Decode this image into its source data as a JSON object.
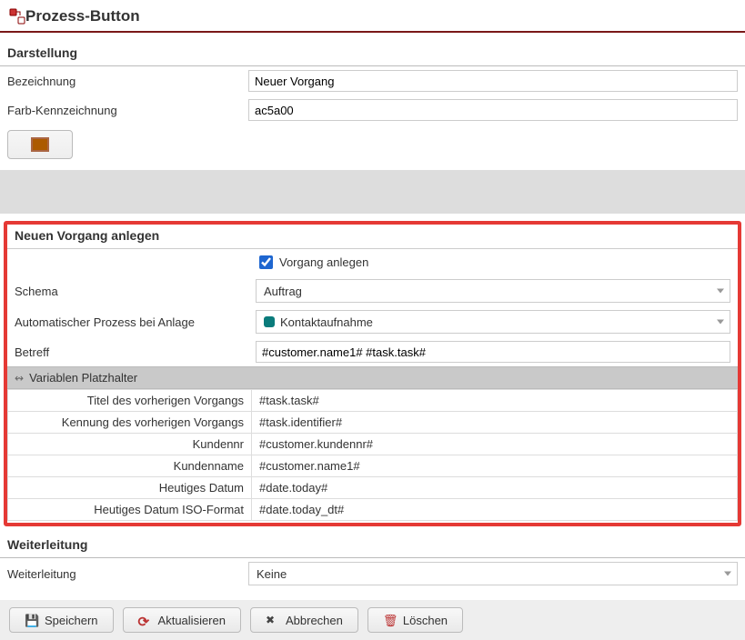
{
  "header": {
    "title": "Prozess-Button"
  },
  "sections": {
    "darstellung": {
      "title": "Darstellung",
      "bezeichnung_label": "Bezeichnung",
      "bezeichnung_value": "Neuer Vorgang",
      "farb_label": "Farb-Kennzeichnung",
      "farb_value": "ac5a00"
    },
    "neu": {
      "title": "Neuen Vorgang anlegen",
      "checkbox_label": "Vorgang anlegen",
      "schema_label": "Schema",
      "schema_value": "Auftrag",
      "autoproc_label": "Automatischer Prozess bei Anlage",
      "autoproc_value": "Kontaktaufnahme",
      "betreff_label": "Betreff",
      "betreff_value": "#customer.name1# #task.task#",
      "var_header": "Variablen Platzhalter",
      "vars": [
        {
          "k": "Titel des vorherigen Vorgangs",
          "v": "#task.task#"
        },
        {
          "k": "Kennung des vorherigen Vorgangs",
          "v": "#task.identifier#"
        },
        {
          "k": "Kundennr",
          "v": "#customer.kundennr#"
        },
        {
          "k": "Kundenname",
          "v": "#customer.name1#"
        },
        {
          "k": "Heutiges Datum",
          "v": "#date.today#"
        },
        {
          "k": "Heutiges Datum ISO-Format",
          "v": "#date.today_dt#"
        }
      ]
    },
    "weiterleitung": {
      "title": "Weiterleitung",
      "label": "Weiterleitung",
      "value": "Keine"
    }
  },
  "footer": {
    "save": "Speichern",
    "refresh": "Aktualisieren",
    "cancel": "Abbrechen",
    "delete": "Löschen"
  }
}
